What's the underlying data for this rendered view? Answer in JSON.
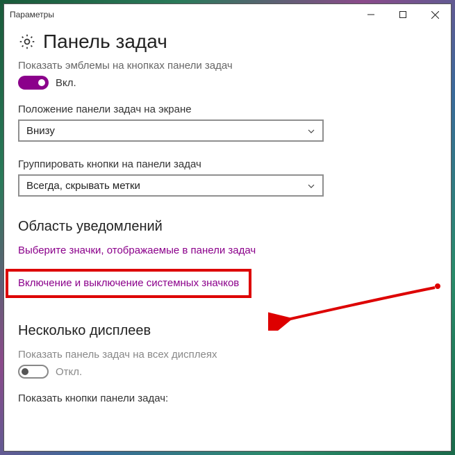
{
  "titlebar": {
    "title": "Параметры"
  },
  "page": {
    "heading": "Панель задач",
    "opt_emblems_label": "Показать эмблемы на кнопках панели задач",
    "opt_emblems_toggle": "Вкл.",
    "opt_position_label": "Положение панели задач на экране",
    "opt_position_value": "Внизу",
    "opt_group_label": "Группировать кнопки на панели задач",
    "opt_group_value": "Всегда, скрывать метки",
    "section_notify": "Область уведомлений",
    "link_select_icons": "Выберите значки, отображаемые в панели задач",
    "link_system_icons": "Включение и выключение системных значков",
    "section_displays": "Несколько дисплеев",
    "opt_show_all_label": "Показать панель задач на всех дисплеях",
    "opt_show_all_toggle": "Откл.",
    "opt_show_buttons_label": "Показать кнопки панели задач:"
  }
}
